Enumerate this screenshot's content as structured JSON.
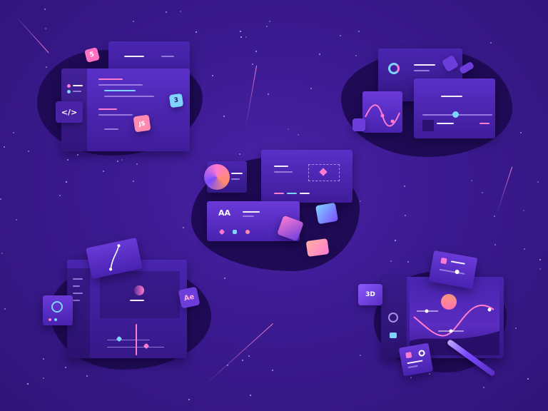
{
  "badges": {
    "html": "5",
    "css": "3",
    "js": "JS",
    "code": "</>",
    "ae": "Ae",
    "threed": "3D",
    "typeface": "AA",
    "bezier": "I"
  },
  "colors": {
    "background": "#3a1a8a",
    "blob": "#1f0b55",
    "accent_pink": "#ff7bd0",
    "accent_cyan": "#7fd4ff",
    "accent_orange": "#ff8a6a"
  },
  "icons": [
    "code-icon",
    "html5-icon",
    "css3-icon",
    "js-icon",
    "donut-chart-icon",
    "wave-chart-icon",
    "pen-tool-icon",
    "ae-icon",
    "cube-3d-icon",
    "stylus-icon",
    "sun-icon",
    "compass-icon"
  ]
}
